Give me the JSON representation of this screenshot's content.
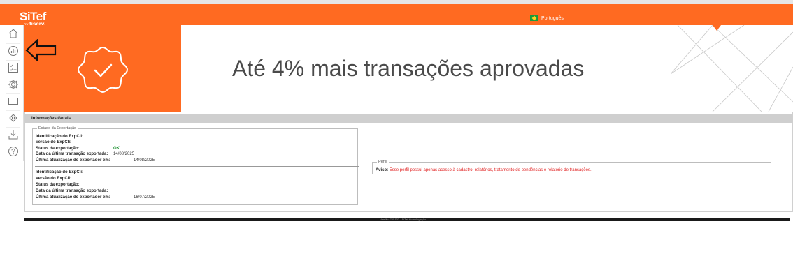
{
  "header": {
    "logo": "SiTef",
    "logo_sub_prefix": "by",
    "logo_sub_brand": "fiserv.",
    "language": "Português",
    "brand_color": "#ff6a21"
  },
  "sidebar": {
    "items": [
      {
        "name": "home-icon"
      },
      {
        "name": "chart-icon"
      },
      {
        "name": "checklist-icon"
      },
      {
        "name": "gear-icon"
      },
      {
        "name": "card-icon"
      },
      {
        "name": "puzzle-icon"
      },
      {
        "name": "download-icon"
      },
      {
        "name": "help-icon"
      }
    ]
  },
  "hero": {
    "text": "Até 4% mais transações aprovadas",
    "badge_icon": "check-badge-icon"
  },
  "panel": {
    "title": "Informações Gerais",
    "export_status": {
      "legend": "Estado da Exportação",
      "block1": {
        "id_label": "Identificação do ExpCli:",
        "version_label": "Versão do ExpCli:",
        "status_label": "Status da exportação:",
        "status_value": "OK",
        "last_tx_label": "Data da última transação exportada:",
        "last_tx_value": "14/08/2025",
        "last_update_label": "Última atualização do exportador em:",
        "last_update_value": "14/08/2025"
      },
      "block2": {
        "id_label": "Identificação do ExpCli:",
        "version_label": "Versão do ExpCli:",
        "status_label": "Status da exportação:",
        "last_tx_label": "Data da última transação exportada:",
        "last_update_label": "Última atualização do exportador em:",
        "last_update_value": "16/07/2025"
      }
    },
    "profile": {
      "legend": "Perfil",
      "warning_label": "Aviso:",
      "warning_text": "Esse perfil possui apenas acesso à cadastro, relatórios, tratamento de pendências e relatório de transações."
    }
  },
  "footer": {
    "version": "Versão: 7.0.102 - SiTef Homologação"
  }
}
